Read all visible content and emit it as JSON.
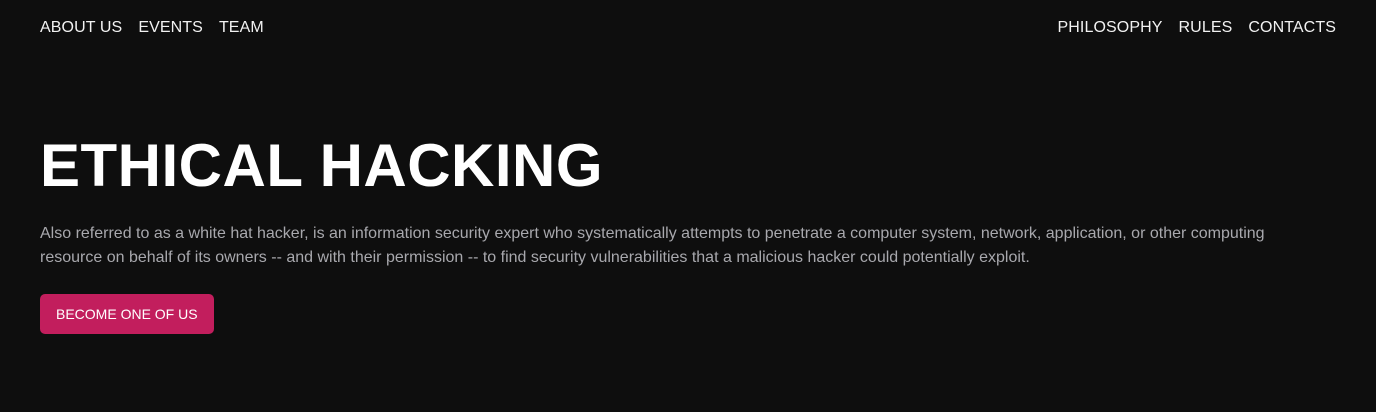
{
  "nav": {
    "left": [
      {
        "label": "ABOUT US"
      },
      {
        "label": "EVENTS"
      },
      {
        "label": "TEAM"
      }
    ],
    "right": [
      {
        "label": "PHILOSOPHY"
      },
      {
        "label": "RULES"
      },
      {
        "label": "CONTACTS"
      }
    ]
  },
  "hero": {
    "title": "ETHICAL HACKING",
    "description": "Also referred to as a white hat hacker, is an information security expert who systematically attempts to penetrate a computer system, network, application, or other computing resource on behalf of its owners -- and with their permission -- to find security vulnerabilities that a malicious hacker could potentially exploit.",
    "cta_label": "BECOME ONE OF US"
  },
  "colors": {
    "background": "#0e0e0e",
    "accent": "#c21e5d",
    "text": "#ffffff",
    "muted_text": "#a8a8ad"
  }
}
